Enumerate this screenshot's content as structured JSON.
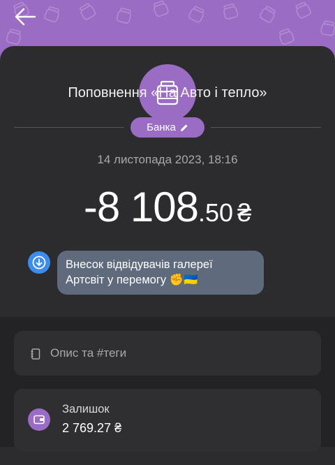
{
  "header": {
    "back_icon": "arrow-left-icon",
    "pattern_icon": "jar-icon",
    "background_color": "#9a6cc4"
  },
  "jar": {
    "icon": "jar-icon"
  },
  "title": "Поповнення «На Авто і тепло»",
  "chip": {
    "label": "Банка",
    "icon": "pencil-icon"
  },
  "date": "14 листопада 2023, 18:16",
  "amount": {
    "integer": "-8 108",
    "decimal": ".50",
    "currency": "₴"
  },
  "message": {
    "icon": "download-circle-icon",
    "line1": "Внесок відвідувачів галереї",
    "line2": "Артсвіт у перемогу ✊🇺🇦"
  },
  "description": {
    "label": "Опис та #теги",
    "icon": "notebook-icon"
  },
  "balance": {
    "label": "Залишок",
    "value": "2 769.27 ₴",
    "icon": "wallet-icon"
  },
  "colors": {
    "accent": "#9a6cc4",
    "sheet": "#2c2c2e",
    "bubble": "#5f6b7c",
    "info": "#3b8ef0"
  }
}
